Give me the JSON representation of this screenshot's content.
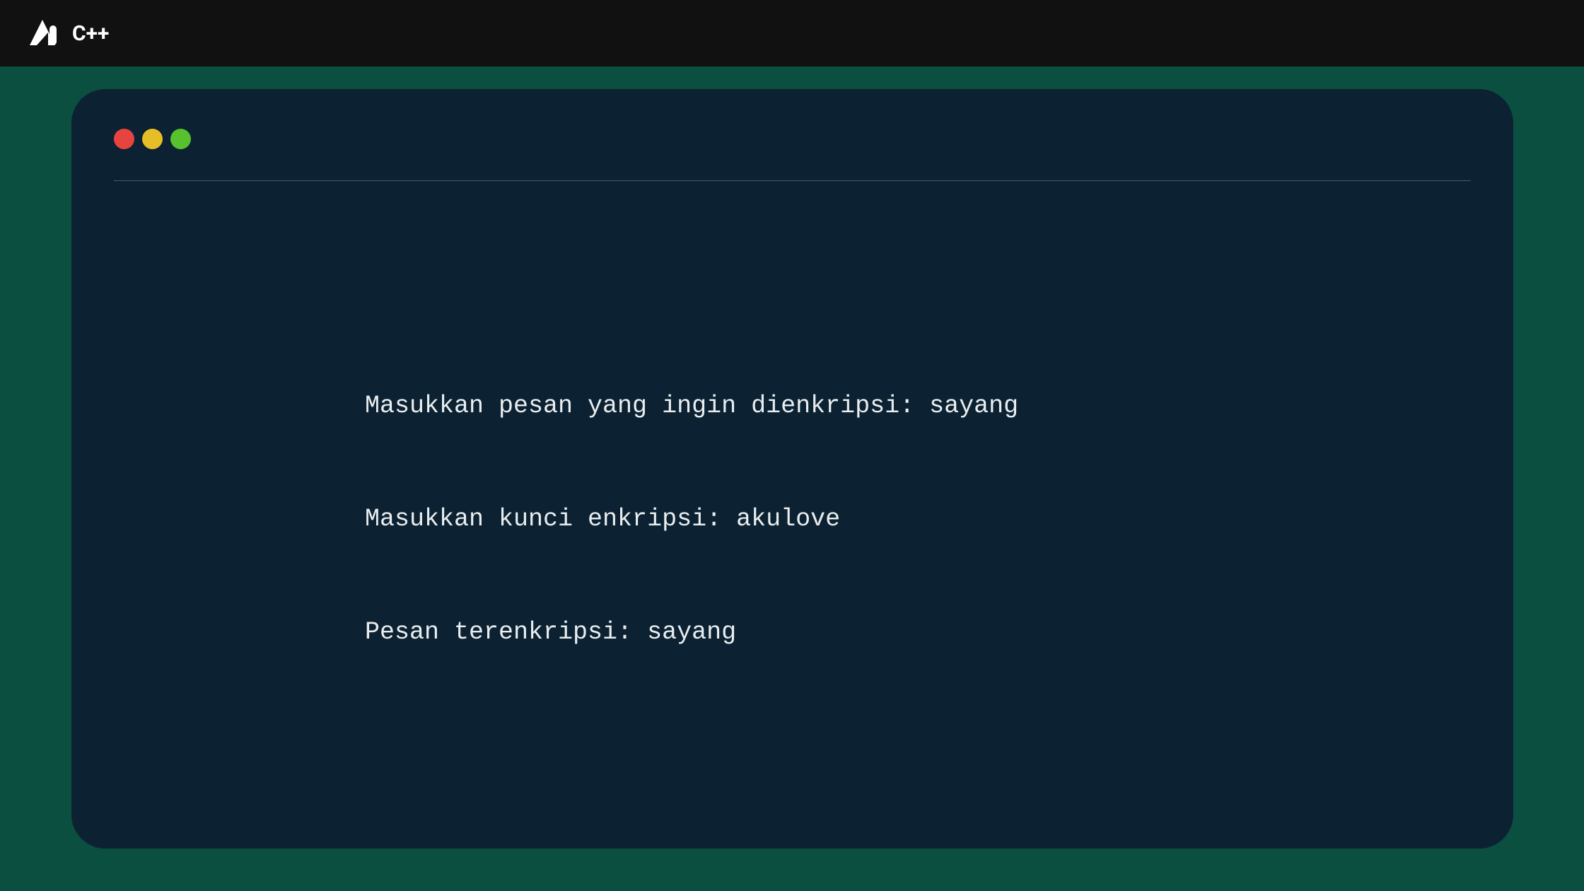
{
  "header": {
    "language": "C++"
  },
  "terminal": {
    "lines": [
      "Masukkan pesan yang ingin dienkripsi: sayang",
      "Masukkan kunci enkripsi: akulove",
      "Pesan terenkripsi: sayang"
    ]
  },
  "window_controls": {
    "colors": {
      "red": "#e8443f",
      "yellow": "#e6be27",
      "green": "#57c22d"
    }
  }
}
